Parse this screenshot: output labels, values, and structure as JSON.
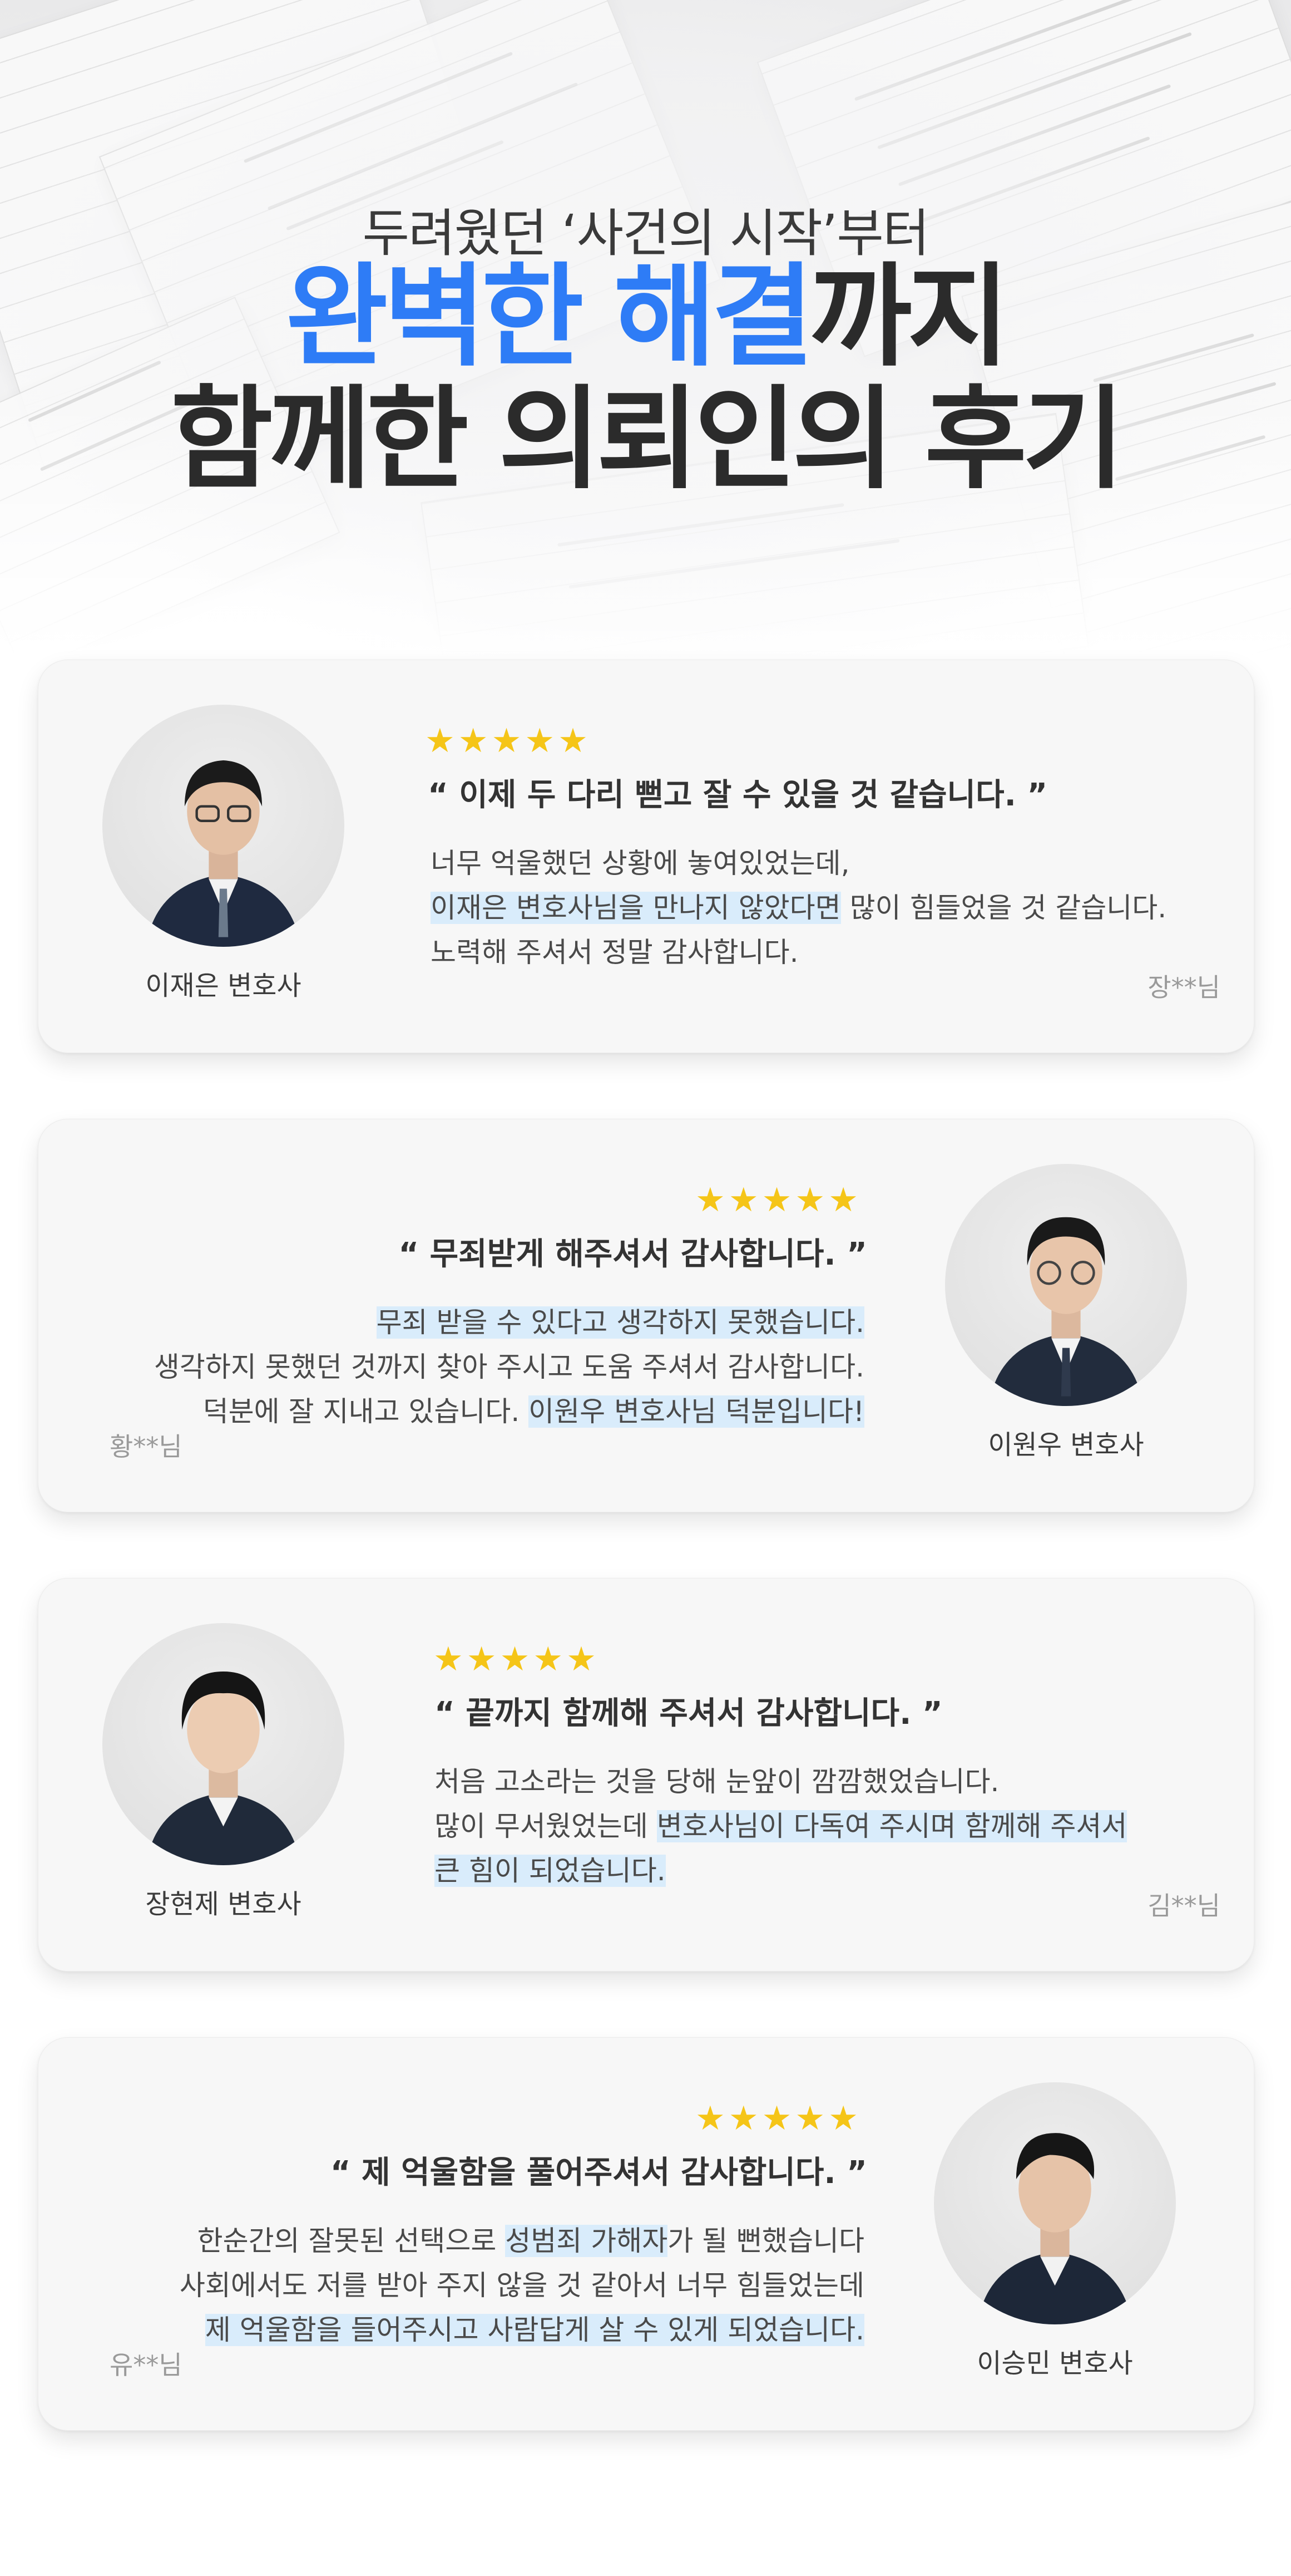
{
  "hero": {
    "subtitle": "두려웠던 ‘사건의 시작’부터",
    "title_accent": "완벽한 해결",
    "title_rest": "까지",
    "title_line2": "함께한 의뢰인의 후기"
  },
  "reviews": [
    {
      "stars": "★★★★★",
      "lawyer": "이재은 변호사",
      "quote": "“ 이제 두 다리 뻗고 잘 수 있을 것 같습니다. ”",
      "lines": [
        [
          {
            "t": "너무 억울했던 상황에 놓여있었는데,",
            "h": false
          }
        ],
        [
          {
            "t": "이재은 변호사님을 만나지 않았다면",
            "h": true
          },
          {
            "t": " 많이 힘들었을 것 같습니다.",
            "h": false
          }
        ],
        [
          {
            "t": "노력해 주셔서 정말 감사합니다.",
            "h": false
          }
        ]
      ],
      "client": "장**님"
    },
    {
      "stars": "★★★★★",
      "lawyer": "이원우 변호사",
      "quote": "“ 무죄받게 해주셔서 감사합니다. ”",
      "lines": [
        [
          {
            "t": "무죄 받을 수 있다고 생각하지 못했습니다.",
            "h": true
          }
        ],
        [
          {
            "t": "생각하지 못했던 것까지 찾아 주시고 도움 주셔서 감사합니다.",
            "h": false
          }
        ],
        [
          {
            "t": "덕분에 잘 지내고 있습니다. ",
            "h": false
          },
          {
            "t": "이원우 변호사님 덕분입니다!",
            "h": true
          }
        ]
      ],
      "client": "황**님"
    },
    {
      "stars": "★★★★★",
      "lawyer": "장현제 변호사",
      "quote": "“ 끝까지 함께해 주셔서 감사합니다. ”",
      "lines": [
        [
          {
            "t": "처음 고소라는 것을 당해 눈앞이 깜깜했었습니다.",
            "h": false
          }
        ],
        [
          {
            "t": "많이 무서웠었는데 ",
            "h": false
          },
          {
            "t": "변호사님이 다독여 주시며 함께해 주셔서",
            "h": true
          }
        ],
        [
          {
            "t": "큰 힘이 되었습니다.",
            "h": true
          }
        ]
      ],
      "client": "김**님"
    },
    {
      "stars": "★★★★★",
      "lawyer": "이승민 변호사",
      "quote": "“ 제 억울함을 풀어주셔서 감사합니다. ”",
      "lines": [
        [
          {
            "t": "한순간의 잘못된 선택으로 ",
            "h": false
          },
          {
            "t": "성범죄 가해자",
            "h": true
          },
          {
            "t": "가 될 뻔했습니다",
            "h": false
          }
        ],
        [
          {
            "t": "사회에서도 저를 받아 주지 않을 것 같아서 너무 힘들었는데",
            "h": false
          }
        ],
        [
          {
            "t": "제 억울함을 들어주시고 사람답게 살 수 있게 되었습니다.",
            "h": true
          }
        ]
      ],
      "client": "유**님"
    }
  ]
}
